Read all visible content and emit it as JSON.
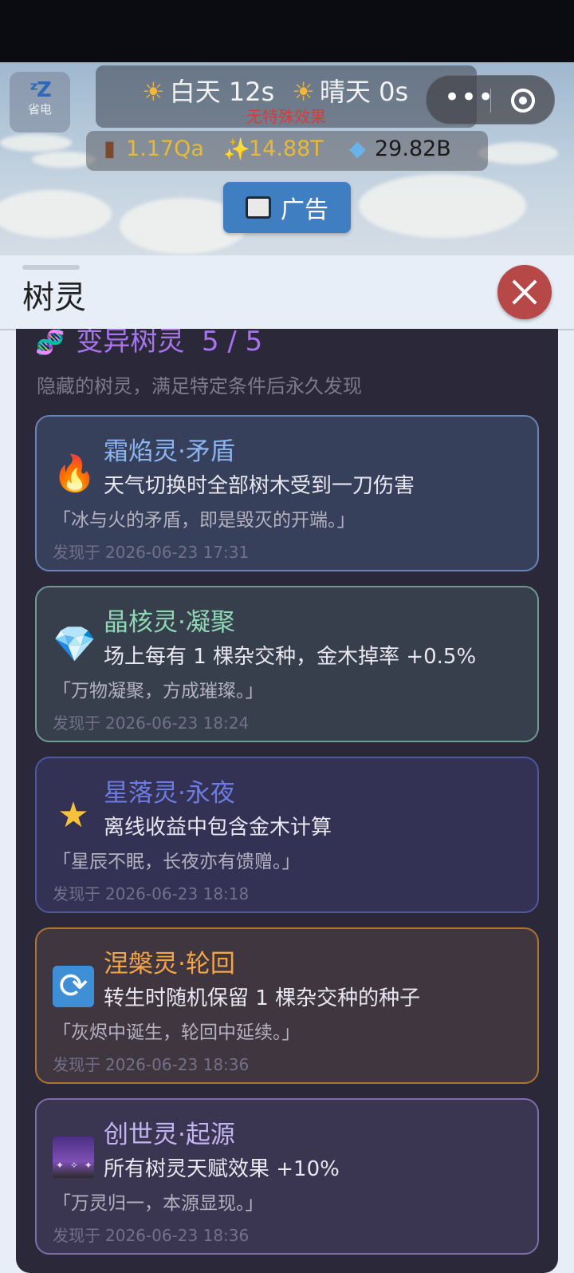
{
  "top_bar": {
    "sleep_icon": "zzz-icon",
    "sleep_label": "省电",
    "weather": {
      "day_label": "白天 12s",
      "sky_label": "晴天 0s",
      "effect_text": "无特殊效果",
      "effect_color": "#d63c3c"
    },
    "resources": {
      "wood": "1.17Qa",
      "sparkle": "14.88T",
      "gem": "29.82B",
      "wood_color": "#e6b93a",
      "sparkle_color": "#e6b93a",
      "gem_color": "#1a1a1a"
    },
    "ad_button_label": "广告",
    "capsule": {
      "more_icon": "more-dots-icon",
      "target_icon": "target-icon"
    }
  },
  "panel": {
    "title": "树灵",
    "close_icon": "close-icon"
  },
  "section": {
    "icon": "dna-icon",
    "title": "变异树灵",
    "count": "5 / 5",
    "description": "隐藏的树灵，满足特定条件后永久发现"
  },
  "discovered_prefix": "发现于",
  "cards": [
    {
      "icon": "fire-icon",
      "name": "霜焰灵·矛盾",
      "effect": "天气切换时全部树木受到一刀伤害",
      "quote": "「冰与火的矛盾，即是毁灭的开端。」",
      "time": "2026-06-23 17:31"
    },
    {
      "icon": "gem-icon",
      "name": "晶核灵·凝聚",
      "effect": "场上每有 1 棵杂交种，金木掉率 +0.5%",
      "quote": "「万物凝聚，方成璀璨。」",
      "time": "2026-06-23 18:24"
    },
    {
      "icon": "star-icon",
      "name": "星落灵·永夜",
      "effect": "离线收益中包含金木计算",
      "quote": "「星辰不眠，长夜亦有馈赠。」",
      "time": "2026-06-23 18:18"
    },
    {
      "icon": "cycle-icon",
      "name": "涅槃灵·轮回",
      "effect": "转生时随机保留 1 棵杂交种的种子",
      "quote": "「灰烬中诞生，轮回中延续。」",
      "time": "2026-06-23 18:36"
    },
    {
      "icon": "galaxy-icon",
      "name": "创世灵·起源",
      "effect": "所有树灵天赋效果 +10%",
      "quote": "「万灵归一，本源显现。」",
      "time": "2026-06-23 18:36"
    }
  ]
}
